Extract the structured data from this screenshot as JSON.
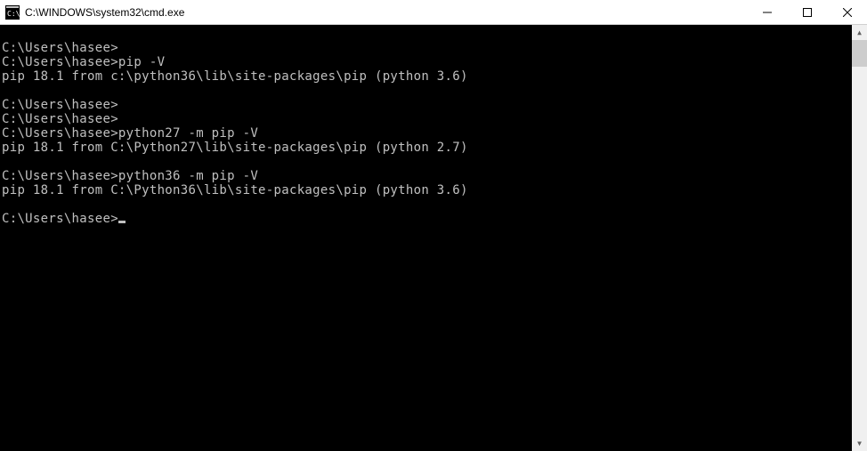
{
  "window": {
    "title": "C:\\WINDOWS\\system32\\cmd.exe"
  },
  "terminal": {
    "lines": [
      "",
      "C:\\Users\\hasee>",
      "C:\\Users\\hasee>pip -V",
      "pip 18.1 from c:\\python36\\lib\\site-packages\\pip (python 3.6)",
      "",
      "C:\\Users\\hasee>",
      "C:\\Users\\hasee>",
      "C:\\Users\\hasee>python27 -m pip -V",
      "pip 18.1 from C:\\Python27\\lib\\site-packages\\pip (python 2.7)",
      "",
      "C:\\Users\\hasee>python36 -m pip -V",
      "pip 18.1 from C:\\Python36\\lib\\site-packages\\pip (python 3.6)",
      ""
    ],
    "current_prompt": "C:\\Users\\hasee>"
  }
}
